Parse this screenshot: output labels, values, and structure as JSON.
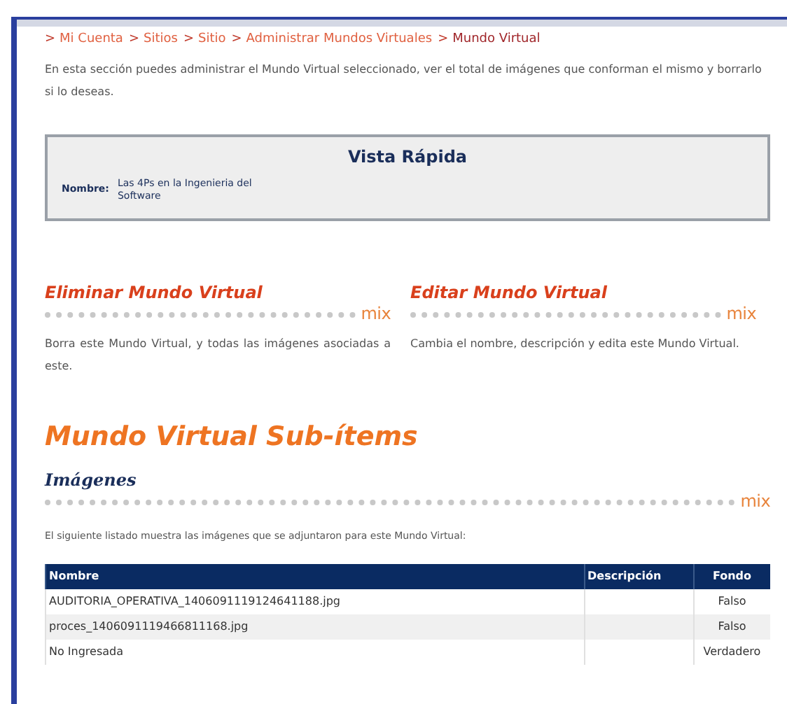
{
  "breadcrumb": [
    {
      "sep": ">",
      "label": "Mi Cuenta",
      "current": false
    },
    {
      "sep": ">",
      "label": "Sitios",
      "current": false
    },
    {
      "sep": ">",
      "label": "Sitio",
      "current": false
    },
    {
      "sep": ">",
      "label": "Administrar Mundos Virtuales",
      "current": false
    },
    {
      "sep": ">",
      "label": "Mundo Virtual",
      "current": true
    }
  ],
  "intro": "En esta sección puedes administrar el Mundo Virtual seleccionado, ver el total de imágenes que conforman el mismo y borrarlo si lo deseas.",
  "quick_view": {
    "title": "Vista Rápida",
    "field_label": "Nombre:",
    "field_value": "Las 4Ps en la Ingenieria del Software"
  },
  "actions": [
    {
      "title": "Eliminar Mundo Virtual",
      "mark": "mix",
      "description": "Borra este Mundo Virtual, y todas las imágenes asociadas a este."
    },
    {
      "title": "Editar Mundo Virtual",
      "mark": "mix",
      "description": "Cambia el nombre, descripción y edita este Mundo Virtual."
    }
  ],
  "subitems_title": "Mundo Virtual Sub-ítems",
  "images_section": {
    "title": "Imágenes",
    "mark": "mix",
    "description": "El siguiente listado muestra las imágenes que se adjuntaron para este Mundo Virtual:"
  },
  "table": {
    "columns": [
      "Nombre",
      "Descripción",
      "Fondo"
    ],
    "rows": [
      [
        "AUDITORIA_OPERATIVA_1406091119124641188.jpg",
        "",
        "Falso"
      ],
      [
        "proces_1406091119466811168.jpg",
        "",
        "Falso"
      ],
      [
        "No Ingresada",
        "",
        "Verdadero"
      ]
    ]
  }
}
